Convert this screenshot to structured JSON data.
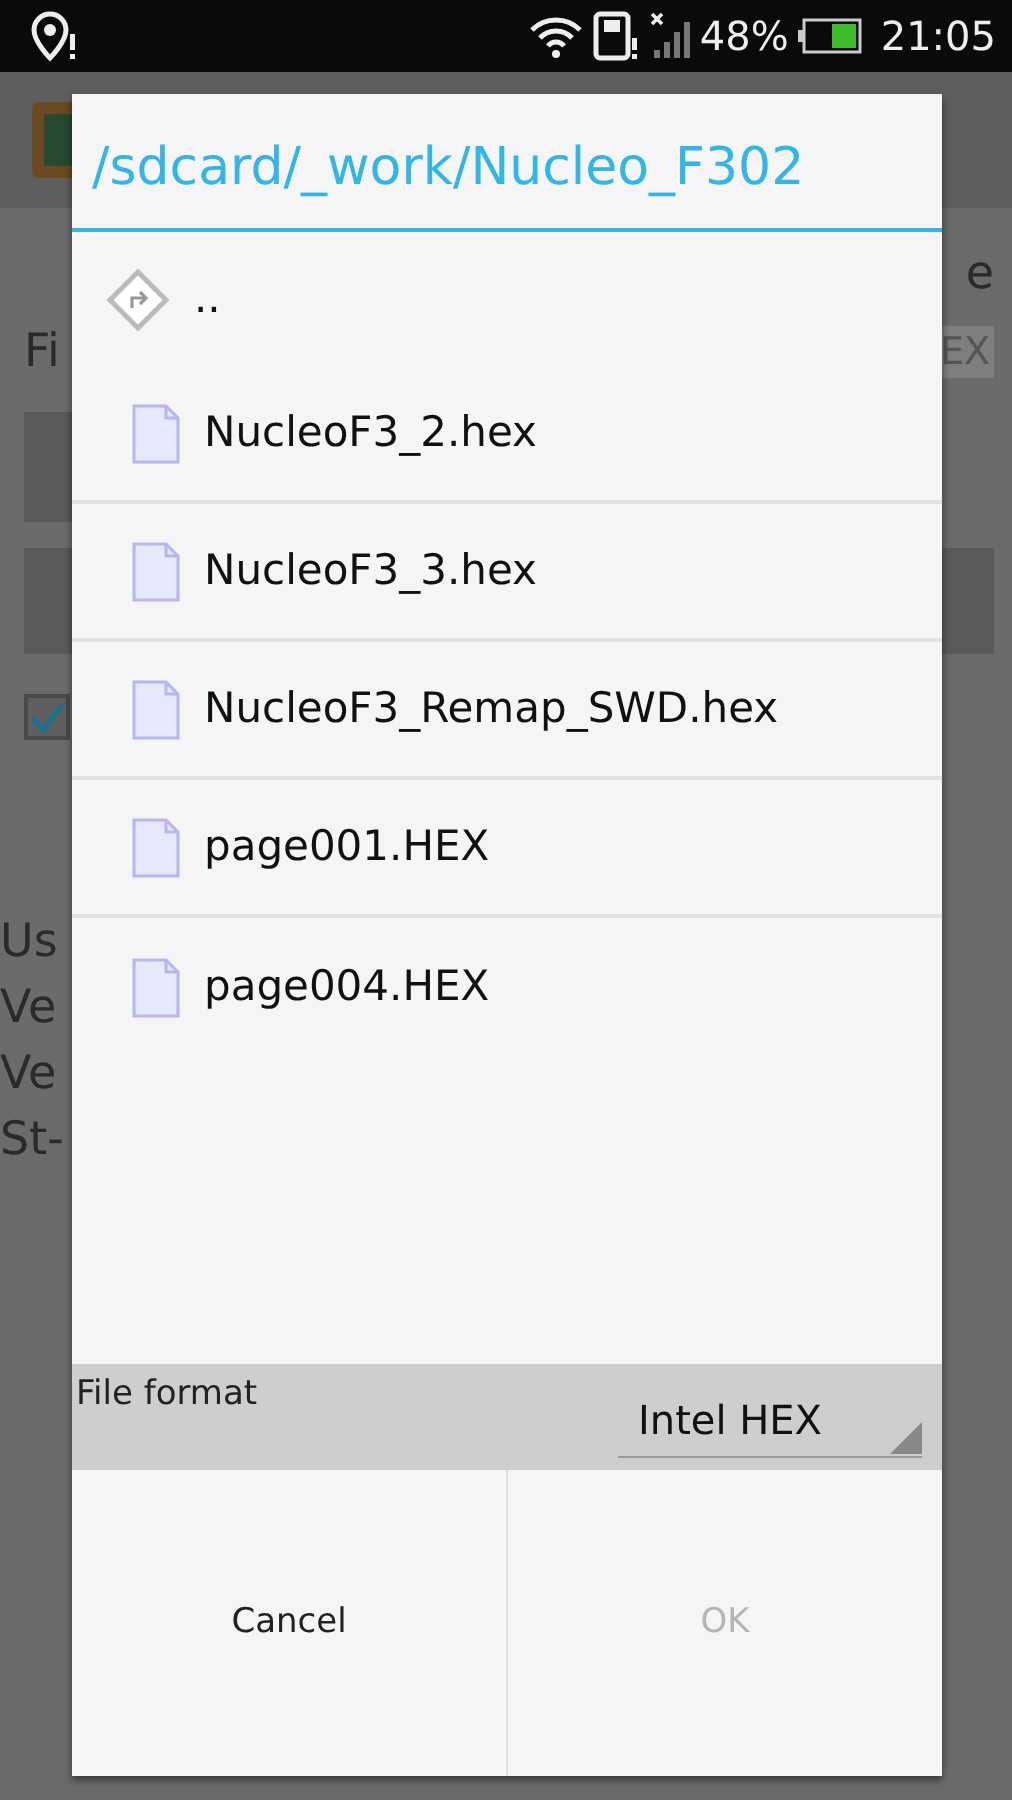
{
  "status_bar": {
    "battery_percent": "48%",
    "time": "21:05"
  },
  "background": {
    "header_fragment": "e",
    "label_fragment": "Fi",
    "format_fragment": "EX",
    "checkbox": {
      "checked": true
    },
    "info_fragments": [
      "Us",
      "Ve",
      "Ve",
      "St-"
    ]
  },
  "dialog": {
    "title": "/sdcard/_work/Nucleo_F302",
    "entries": [
      {
        "kind": "parent",
        "name": ".."
      },
      {
        "kind": "file",
        "name": "NucleoF3_2.hex"
      },
      {
        "kind": "file",
        "name": "NucleoF3_3.hex"
      },
      {
        "kind": "file",
        "name": "NucleoF3_Remap_SWD.hex"
      },
      {
        "kind": "file",
        "name": "page001.HEX"
      },
      {
        "kind": "file",
        "name": "page004.HEX"
      }
    ],
    "file_format": {
      "label": "File format",
      "value": "Intel HEX"
    },
    "buttons": [
      {
        "label": "Cancel",
        "disabled": false
      },
      {
        "label": "OK",
        "disabled": true
      }
    ]
  }
}
